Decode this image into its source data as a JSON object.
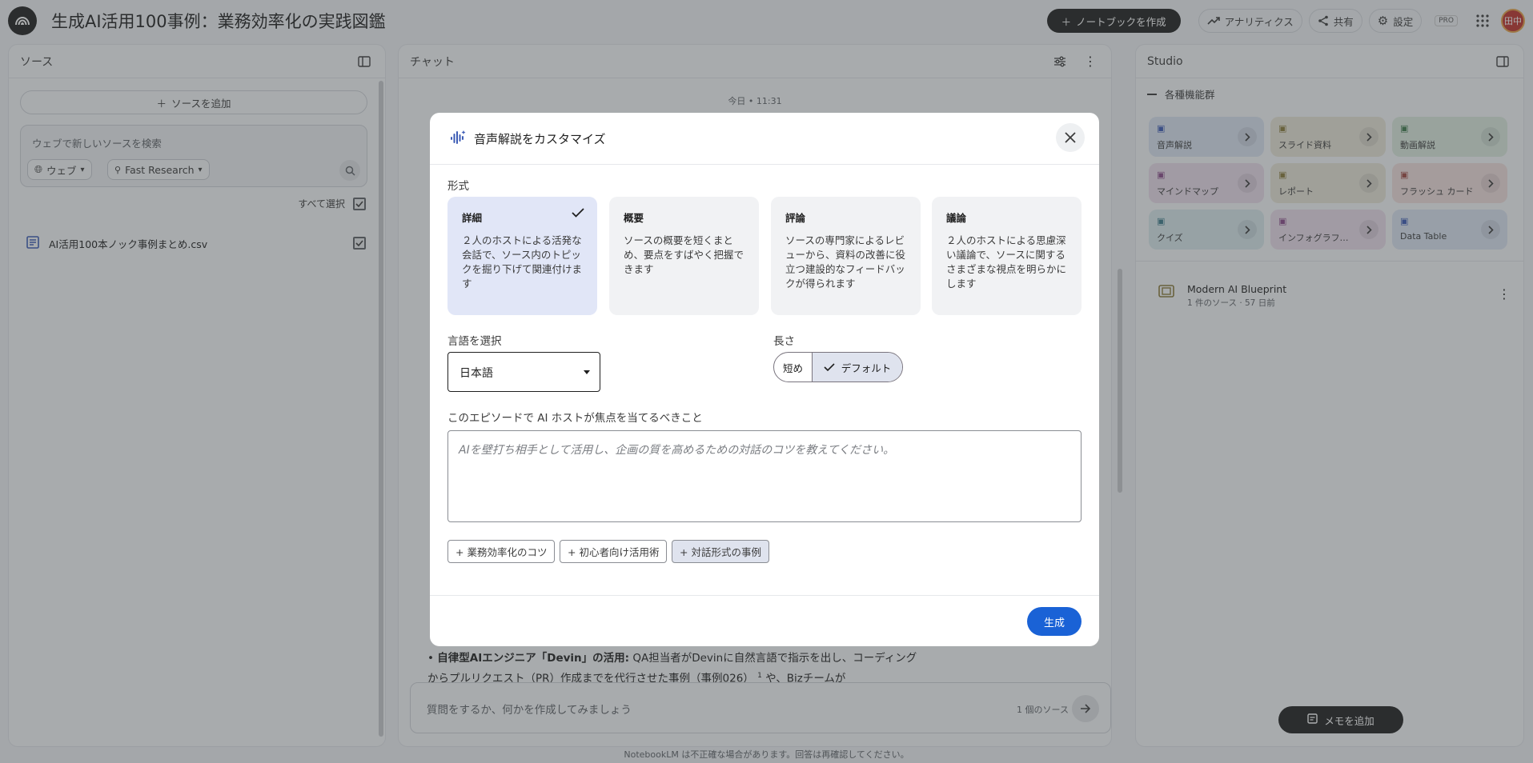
{
  "header": {
    "notebook_title": "生成AI活用100事例：業務効率化の実践図鑑",
    "create_notebook": "ノートブックを作成",
    "analytics": "アナリティクス",
    "share": "共有",
    "settings": "設定",
    "pro_badge": "PRO",
    "avatar_initials": "田中"
  },
  "sources": {
    "title": "ソース",
    "add_source": "ソースを追加",
    "search_placeholder": "ウェブで新しいソースを検索",
    "web_pill": "ウェブ",
    "research_pill": "Fast Research",
    "select_all": "すべて選択",
    "items": [
      {
        "name": "AI活用100本ノック事例まとめ.csv"
      }
    ]
  },
  "chat": {
    "title": "チャット",
    "timestamp": "今日 • 11:31",
    "body_bold": "自律型AIエンジニア「Devin」の活用:",
    "body_text": " QA担当者がDevinに自然言語で指示を出し、コーディングからプルリクエスト（PR）作成までを代行させた事例（事例026）",
    "citation": "1",
    "body_tail": " や、Bizチームが",
    "input_placeholder": "質問をするか、何かを作成してみましょう",
    "source_count": "1 個のソース",
    "footer_note": "NotebookLM は不正確な場合があります。回答は再確認してください。"
  },
  "studio": {
    "title": "Studio",
    "feature_group": "各種機能群",
    "tiles": [
      {
        "label": "音声解説",
        "icon": "audio-icon",
        "bg": "#dbe4f2",
        "accent": "#3b5bb5"
      },
      {
        "label": "スライド資料",
        "icon": "slides-icon",
        "bg": "#e9e6d8",
        "accent": "#8a7a3a"
      },
      {
        "label": "動画解説",
        "icon": "video-icon",
        "bg": "#dcebdf",
        "accent": "#3f7a4c"
      },
      {
        "label": "マインドマップ",
        "icon": "mindmap-icon",
        "bg": "#eadcea",
        "accent": "#8a4a8a"
      },
      {
        "label": "レポート",
        "icon": "report-icon",
        "bg": "#e9e6d8",
        "accent": "#8a7a3a"
      },
      {
        "label": "フラッシュ カード",
        "icon": "flashcard-icon",
        "bg": "#f1dedd",
        "accent": "#a04a44"
      },
      {
        "label": "クイズ",
        "icon": "quiz-icon",
        "bg": "#d9e8ed",
        "accent": "#3d7b8a"
      },
      {
        "label": "インフォグラフィック",
        "icon": "infographic-icon",
        "bg": "#eadcea",
        "accent": "#8a4a8a"
      },
      {
        "label": "Data Table",
        "icon": "table-icon",
        "bg": "#dbe4f2",
        "accent": "#3b5bb5"
      }
    ],
    "note": {
      "title": "Modern AI Blueprint",
      "subtitle": "1 件のソース · 57 日前"
    },
    "add_memo": "メモを追加"
  },
  "dialog": {
    "title": "音声解説をカスタマイズ",
    "format_label": "形式",
    "formats": [
      {
        "title": "詳細",
        "desc": "２人のホストによる活発な会話で、ソース内のトピックを掘り下げて関連付けます",
        "selected": true
      },
      {
        "title": "概要",
        "desc": "ソースの概要を短くまとめ、要点をすばやく把握できます",
        "selected": false
      },
      {
        "title": "評論",
        "desc": "ソースの専門家によるレビューから、資料の改善に役立つ建設的なフィードバックが得られます",
        "selected": false
      },
      {
        "title": "議論",
        "desc": "２人のホストによる思慮深い議論で、ソースに関するさまざまな視点を明らかにします",
        "selected": false
      }
    ],
    "language_label": "言語を選択",
    "language_value": "日本語",
    "length_label": "長さ",
    "length_short": "短め",
    "length_default": "デフォルト",
    "focus_label": "このエピソードで AI ホストが焦点を当てるべきこと",
    "focus_placeholder": "AIを壁打ち相手として活用し、企画の質を高めるための対話のコツを教えてください。",
    "suggestions": [
      "+ 業務効率化のコツ",
      "+ 初心者向け活用術",
      "+ 対話形式の事例"
    ],
    "generate": "生成"
  },
  "colors": {
    "accent_blue": "#1a62d6",
    "selected_card": "#e1e6f7"
  }
}
